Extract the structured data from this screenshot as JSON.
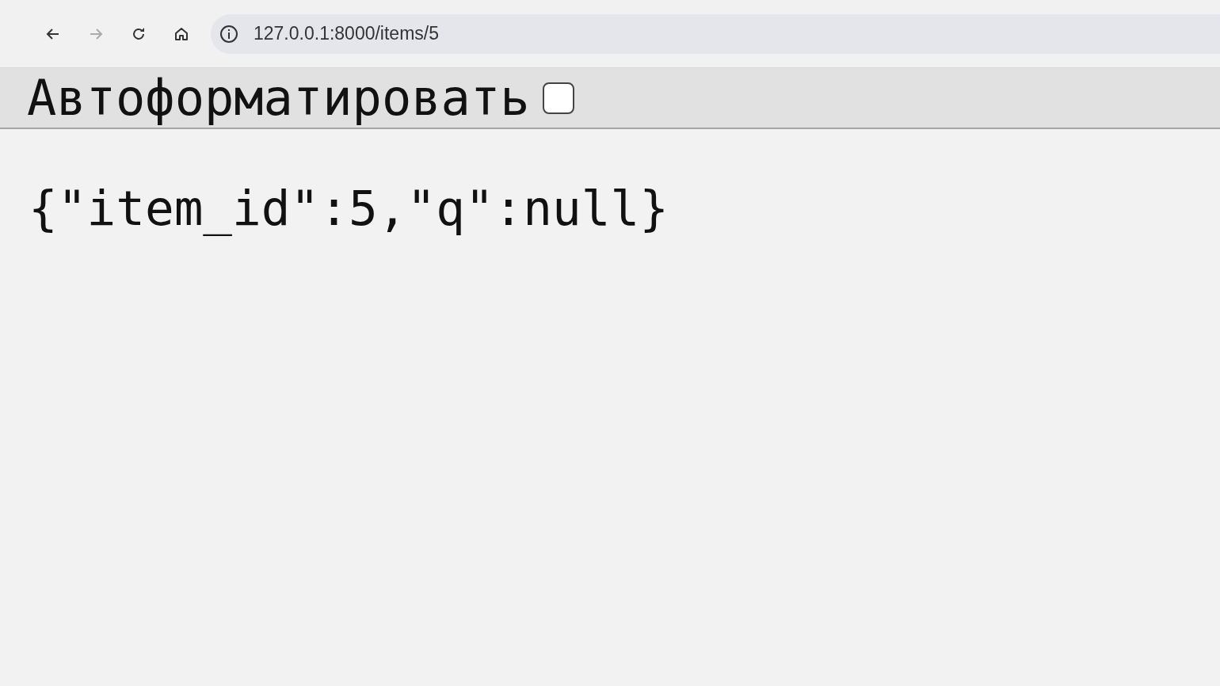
{
  "browser": {
    "nav_buttons": [
      {
        "kind": "back",
        "disabled": false
      },
      {
        "kind": "forward",
        "disabled": true
      },
      {
        "kind": "reload",
        "disabled": false
      },
      {
        "kind": "home",
        "disabled": false
      }
    ],
    "address": "127.0.0.1:8000/items/5"
  },
  "toolbar": {
    "label": "Автоформатировать",
    "checked": false
  },
  "body": "{\"item_id\":5,\"q\":null}"
}
